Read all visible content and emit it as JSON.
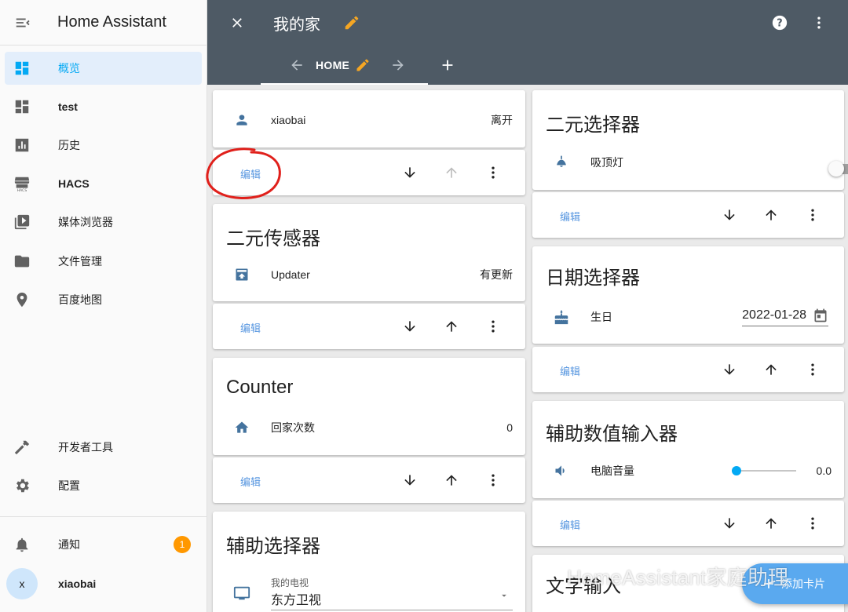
{
  "sidebar": {
    "title": "Home Assistant",
    "items": [
      {
        "label": "概览",
        "icon": "view-dashboard-icon"
      },
      {
        "label": "test",
        "icon": "view-dashboard-icon"
      },
      {
        "label": "历史",
        "icon": "chart-box-icon"
      },
      {
        "label": "HACS",
        "icon": "hacs-store-icon"
      },
      {
        "label": "媒体浏览器",
        "icon": "play-box-multiple-icon"
      },
      {
        "label": "文件管理",
        "icon": "folder-icon"
      },
      {
        "label": "百度地图",
        "icon": "map-marker-icon"
      }
    ],
    "tools": [
      {
        "label": "开发者工具",
        "icon": "hammer-icon"
      },
      {
        "label": "配置",
        "icon": "cog-icon"
      }
    ],
    "notifications": {
      "label": "通知",
      "count": "1"
    },
    "user": {
      "initial": "x",
      "name": "xiaobai"
    }
  },
  "header": {
    "title": "我的家",
    "tab": "HOME"
  },
  "cards": {
    "person": {
      "name": "xiaobai",
      "state": "离开"
    },
    "binary_sensor": {
      "title": "二元传感器",
      "name": "Updater",
      "state": "有更新"
    },
    "counter": {
      "title": "Counter",
      "name": "回家次数",
      "state": "0"
    },
    "input_select": {
      "title": "辅助选择器",
      "label": "我的电视",
      "value": "东方卫视"
    },
    "input_boolean": {
      "title": "二元选择器",
      "name": "吸顶灯"
    },
    "input_datetime": {
      "title": "日期选择器",
      "name": "生日",
      "value": "2022-01-28"
    },
    "input_number": {
      "title": "辅助数值输入器",
      "name": "电脑音量",
      "value": "0.0",
      "fraction": 0
    },
    "input_text": {
      "title": "文字输入"
    }
  },
  "edit_label": "编辑",
  "fab_label": "添加卡片",
  "watermark": "HomeAssistant家庭助理",
  "colors": {
    "header": "#4e5a65",
    "accent": "#03a9f4",
    "pencil": "#f5a623",
    "badge": "#ff9800",
    "annotation": "#e0201b"
  }
}
